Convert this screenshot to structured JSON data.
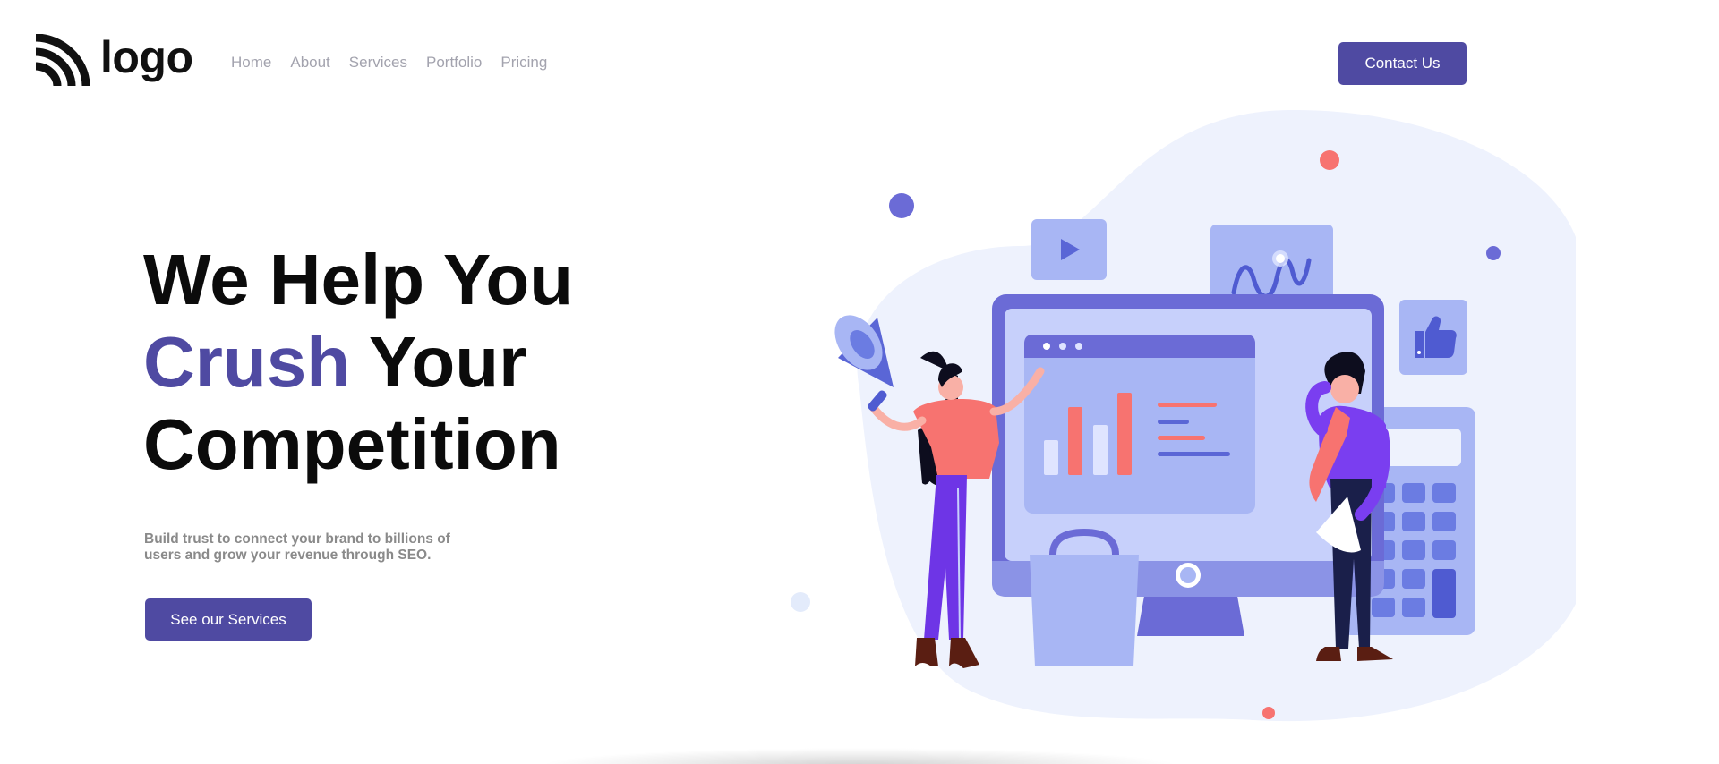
{
  "header": {
    "logo_text": "logo",
    "nav": [
      {
        "label": "Home"
      },
      {
        "label": "About"
      },
      {
        "label": "Services"
      },
      {
        "label": "Portfolio"
      },
      {
        "label": "Pricing"
      }
    ],
    "contact_label": "Contact Us"
  },
  "hero": {
    "title_line1": "We Help You",
    "title_accent": "Crush",
    "title_line2_rest": " Your",
    "title_line3": "Competition",
    "subtitle": "Build trust to connect your brand to billions of users and grow your revenue through SEO.",
    "cta_label": "See our Services"
  },
  "colors": {
    "brand": "#4f4aa2",
    "nav_text": "#a3a3ae",
    "subtitle_text": "#8a8a8a",
    "illustration_blob": "#eef2fd",
    "illustration_accent": "#f77370"
  },
  "illustration": {
    "icons": [
      "megaphone-icon",
      "play-icon",
      "wave-chart-icon",
      "thumbs-up-icon",
      "bar-chart-icon",
      "calculator-icon",
      "shopping-bag-icon",
      "monitor-icon"
    ]
  }
}
